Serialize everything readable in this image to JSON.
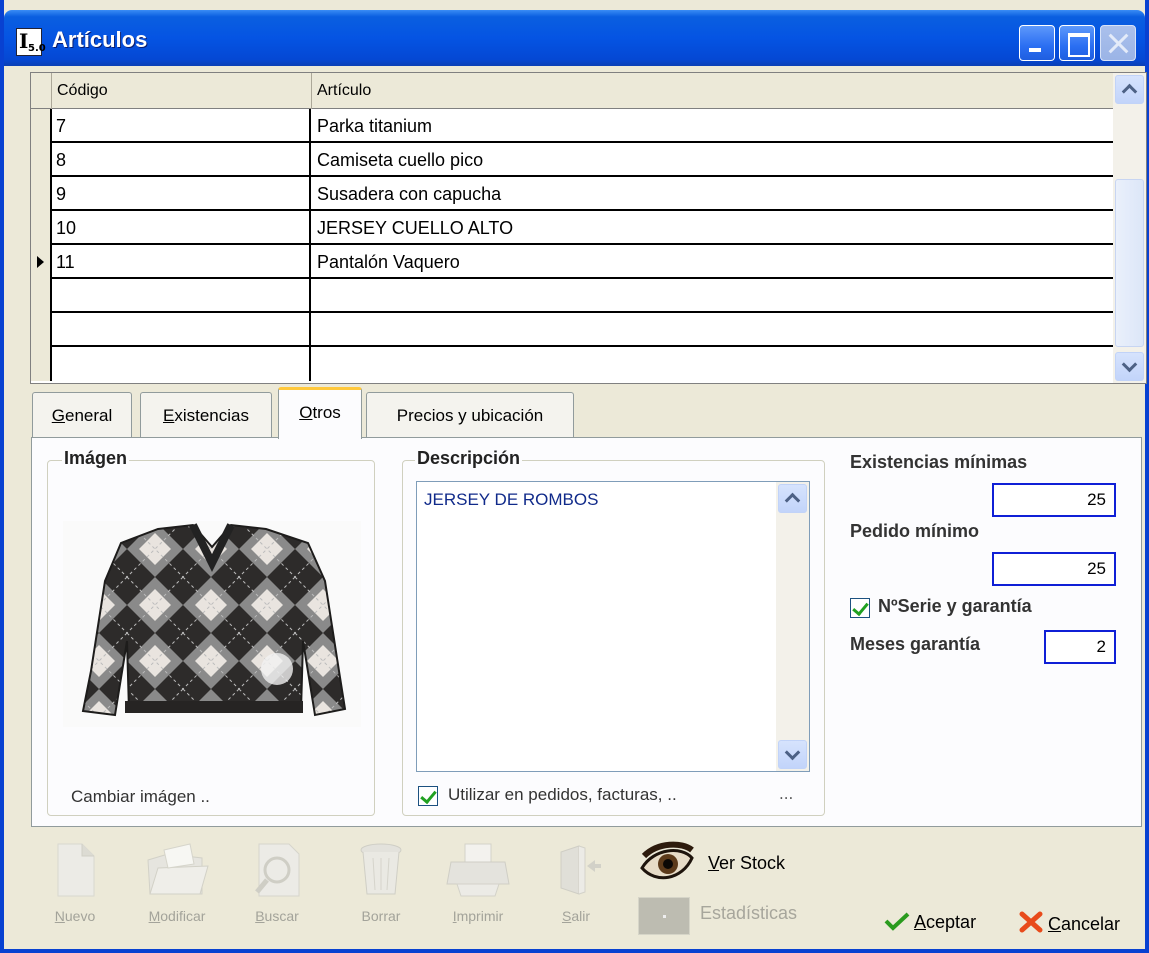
{
  "window": {
    "title": "Artículos",
    "icon_text_1": "I",
    "icon_text_2": "5.0"
  },
  "grid": {
    "columns": [
      "Código",
      "Artículo"
    ],
    "rows": [
      {
        "code": "7",
        "article": "Parka titanium",
        "current": false
      },
      {
        "code": "8",
        "article": "Camiseta cuello pico",
        "current": false
      },
      {
        "code": "9",
        "article": "Susadera con capucha",
        "current": false
      },
      {
        "code": "10",
        "article": "JERSEY CUELLO ALTO",
        "current": false
      },
      {
        "code": "11",
        "article": "Pantalón  Vaquero",
        "current": true
      },
      {
        "code": "",
        "article": "",
        "current": false
      },
      {
        "code": "",
        "article": "",
        "current": false
      },
      {
        "code": "",
        "article": "",
        "current": false
      }
    ]
  },
  "tabs": [
    {
      "label_u": "G",
      "label_rest": "eneral",
      "active": false
    },
    {
      "label_u": "E",
      "label_rest": "xistencias",
      "active": false
    },
    {
      "label_u": "O",
      "label_rest": "tros",
      "active": true
    },
    {
      "label_u": "",
      "label_rest": "Precios y ubicación",
      "active": false
    }
  ],
  "image_group": {
    "title": "Imágen",
    "change_label_pre": "Cambiar imá",
    "change_label_u": "g",
    "change_label_post": "en .."
  },
  "description_group": {
    "title": "Descripción",
    "text": "JERSEY DE ROMBOS",
    "use_checkbox_label": "Utilizar en pedidos, facturas, ..",
    "use_checkbox_checked": true,
    "dots": "..."
  },
  "stock": {
    "min_stock_label": "Existencias mínimas",
    "min_stock_value": "25",
    "min_order_label": "Pedido mínimo",
    "min_order_value": "25",
    "serial_label": "NºSerie y garantía",
    "serial_checked": true,
    "warranty_months_label": "Meses garantía",
    "warranty_months_value": "2"
  },
  "toolbar": {
    "nuevo_u": "N",
    "nuevo_rest": "uevo",
    "modificar_u": "M",
    "modificar_rest": "odificar",
    "buscar_u": "B",
    "buscar_rest": "uscar",
    "borrar": "Borrar",
    "imprimir_u": "I",
    "imprimir_rest": "mprimir",
    "salir_u": "S",
    "salir_rest": "alir",
    "ver_stock_u": "V",
    "ver_stock_rest": "er Stock",
    "estadisticas": "Estadísticas",
    "aceptar_u": "A",
    "aceptar_rest": "ceptar",
    "cancelar_u": "C",
    "cancelar_rest": "ancelar"
  },
  "colors": {
    "title_bar": "#0554e3",
    "accent_tab": "#ffc83c",
    "field_border": "#0f1fd6",
    "check_green": "#21a121",
    "cancel_red": "#e84a1a"
  }
}
